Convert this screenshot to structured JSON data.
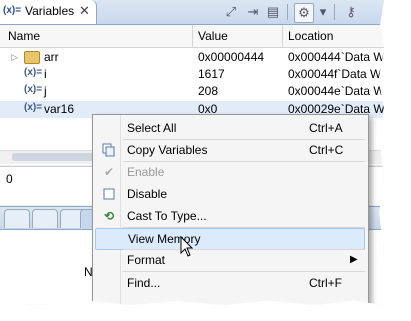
{
  "view": {
    "tab_icon": "(x)=",
    "tab_title": "Variables",
    "close_glyph": "✕"
  },
  "table": {
    "columns": [
      "Name",
      "Value",
      "Location"
    ],
    "rows": [
      {
        "expander": "▷",
        "icon": "folder-icon",
        "name": "arr",
        "value": "0x00000444",
        "location": "0x000444`Data W"
      },
      {
        "expander": "",
        "icon": "(x)=",
        "name": "i",
        "value": "1617",
        "location": "0x00044f`Data W"
      },
      {
        "expander": "",
        "icon": "(x)=",
        "name": "j",
        "value": "208",
        "location": "0x00044e`Data W"
      },
      {
        "expander": "",
        "icon": "(x)=",
        "name": "var16",
        "value": "0x0",
        "location": "0x00029e`Data W"
      }
    ]
  },
  "detail_value": "0",
  "lower_panel_text": "N",
  "context_menu": {
    "items": [
      {
        "label": "Select All",
        "shortcut": "Ctrl+A",
        "icon": ""
      },
      {
        "label": "Copy Variables",
        "shortcut": "Ctrl+C",
        "icon": "copy-icon"
      },
      {
        "label": "Enable",
        "shortcut": "",
        "icon": "checkmark-icon",
        "disabled": true
      },
      {
        "label": "Disable",
        "shortcut": "",
        "icon": "checkbox-icon"
      },
      {
        "label": "Cast To Type...",
        "shortcut": "",
        "icon": "cast-icon"
      },
      {
        "label": "View Memory",
        "shortcut": "",
        "icon": "",
        "highlighted": true
      },
      {
        "label": "Format",
        "shortcut": "",
        "icon": "",
        "submenu": "▶"
      },
      {
        "label": "Find...",
        "shortcut": "Ctrl+F",
        "icon": ""
      }
    ]
  },
  "colors": {
    "selection_row": "#e2ecf8",
    "menu_highlight": "#dcebfc",
    "tab_gradient": "#c8d8ec"
  }
}
